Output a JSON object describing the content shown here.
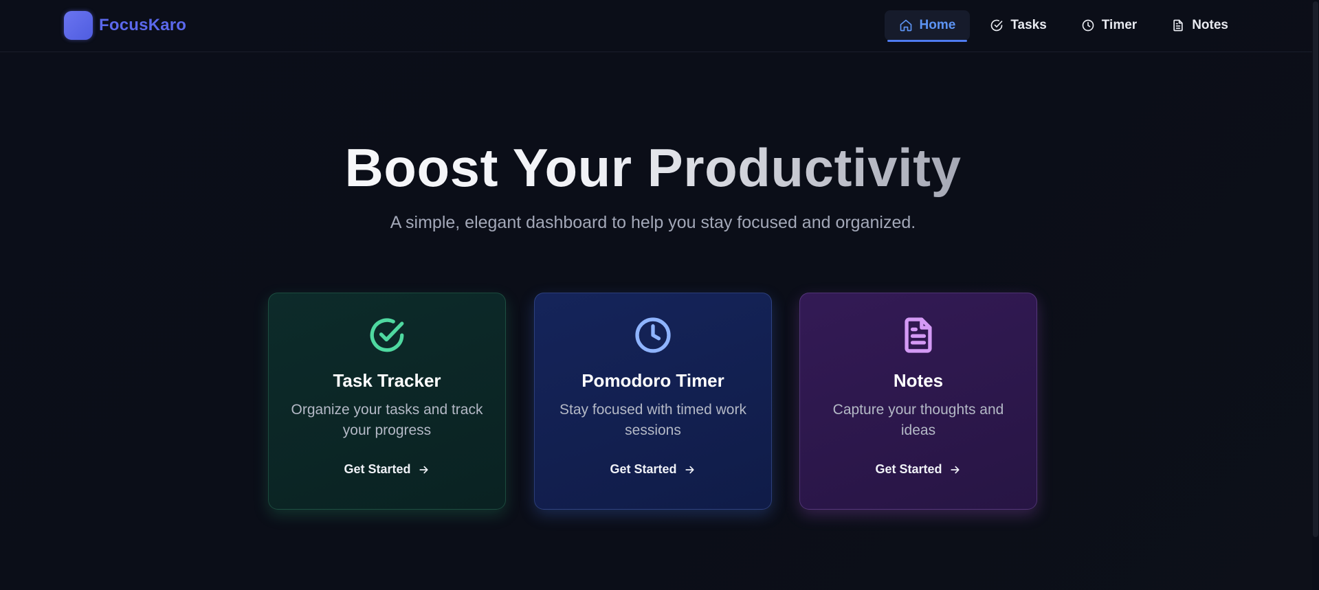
{
  "header": {
    "brand_name": "FocusKaro",
    "nav": [
      {
        "label": "Home",
        "icon": "home-icon",
        "active": true
      },
      {
        "label": "Tasks",
        "icon": "check-circle-icon",
        "active": false
      },
      {
        "label": "Timer",
        "icon": "clock-icon",
        "active": false
      },
      {
        "label": "Notes",
        "icon": "file-text-icon",
        "active": false
      }
    ]
  },
  "hero": {
    "title": "Boost Your Productivity",
    "subtitle": "A simple, elegant dashboard to help you stay focused and organized."
  },
  "cards": [
    {
      "title": "Task Tracker",
      "description": "Organize your tasks and track your progress",
      "cta": "Get Started",
      "icon": "check-circle-icon",
      "accent": "#4fd8a0"
    },
    {
      "title": "Pomodoro Timer",
      "description": "Stay focused with timed work sessions",
      "cta": "Get Started",
      "icon": "clock-icon",
      "accent": "#8fb4ff"
    },
    {
      "title": "Notes",
      "description": "Capture your thoughts and ideas",
      "cta": "Get Started",
      "icon": "file-text-icon",
      "accent": "#d49af5"
    }
  ],
  "colors": {
    "background": "#0b0e18",
    "brand": "#5b68ec",
    "nav_active": "#5d94f4"
  }
}
